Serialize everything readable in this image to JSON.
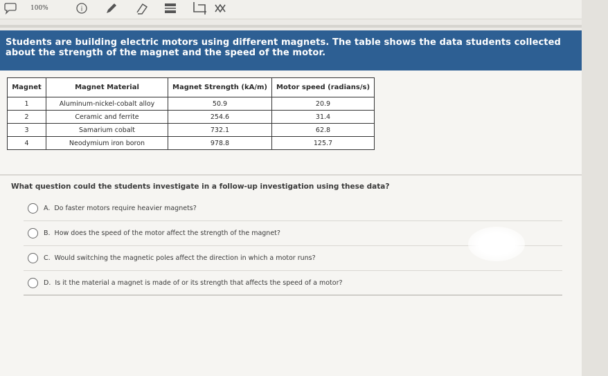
{
  "toolbar": {
    "zoom": "100%",
    "icons": [
      "speech-bubble-icon",
      "circle-info-icon",
      "pen-icon",
      "eraser-icon",
      "highlighter-icon",
      "crop-icon",
      "cross-out-icon"
    ]
  },
  "banner": {
    "text": "Students are building electric motors using different magnets. The table shows the data students collected about the strength of the magnet and the speed of the motor."
  },
  "table": {
    "headers": [
      "Magnet",
      "Magnet Material",
      "Magnet Strength (kA/m)",
      "Motor speed (radians/s)"
    ],
    "rows": [
      [
        "1",
        "Aluminum-nickel-cobalt alloy",
        "50.9",
        "20.9"
      ],
      [
        "2",
        "Ceramic and ferrite",
        "254.6",
        "31.4"
      ],
      [
        "3",
        "Samarium cobalt",
        "732.1",
        "62.8"
      ],
      [
        "4",
        "Neodymium iron boron",
        "978.8",
        "125.7"
      ]
    ]
  },
  "question": {
    "text": "What question could the students investigate in a follow-up investigation using these data?"
  },
  "options": [
    {
      "letter": "A.",
      "text": "Do faster motors require heavier magnets?"
    },
    {
      "letter": "B.",
      "text": "How does the speed of the motor affect the strength of the magnet?"
    },
    {
      "letter": "C.",
      "text": "Would switching the magnetic poles affect the direction in which a motor runs?"
    },
    {
      "letter": "D.",
      "text": "Is it the material a magnet is made of or its strength that affects the speed of a motor?"
    }
  ],
  "colors": {
    "banner": "#2d5f93",
    "background": "#f6f5f2"
  }
}
